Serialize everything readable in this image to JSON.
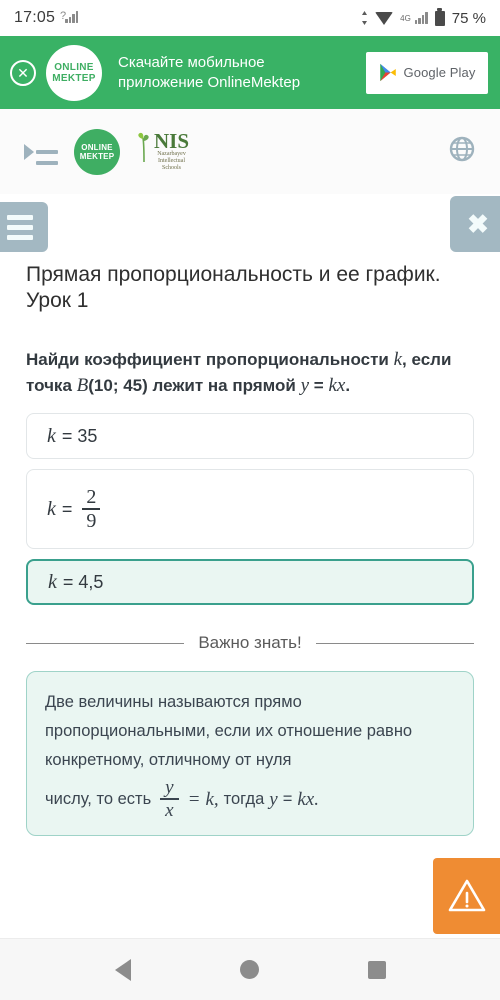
{
  "statusbar": {
    "time": "17:05",
    "signal_icon": "signal-bars-icon",
    "question_mark": "?",
    "arrows": "↕",
    "network": "4G",
    "battery": "75 %"
  },
  "promo": {
    "close_icon": "close-circle-icon",
    "logo_line1": "ONLINE",
    "logo_line2": "MEKTEP",
    "text_line1": "Скачайте мобильное",
    "text_line2": "приложение OnlineMektep",
    "store_button": "Google Play",
    "bg_color": "#39b265"
  },
  "header": {
    "menu_icon": "indent-menu-icon",
    "om_logo_line1": "ONLINE",
    "om_logo_line2": "MEKTEP",
    "nis_logo": "NIS",
    "nis_sub_line1": "Nazarbayev",
    "nis_sub_line2": "Intellectual",
    "nis_sub_line3": "Schools",
    "list_icon": "list-icon",
    "globe_icon": "globe-icon"
  },
  "toolbar": {
    "menu_label": "hamburger-menu",
    "close_label": "✖"
  },
  "lesson": {
    "title": "Прямая пропорциональность и ее график. Урок 1"
  },
  "question": {
    "part1": "Найди коэффициент пропорциональности",
    "var_k": "k",
    "part2": ", если точка",
    "point_b": "B",
    "point_coords": "(10; 45)",
    "part3": "лежит на прямой",
    "formula_y": "y",
    "formula_eq": "=",
    "formula_kx": "kx",
    "period": "."
  },
  "options": [
    {
      "var": "k",
      "eq": "= 35",
      "type": "plain",
      "selected": false
    },
    {
      "var": "k",
      "eq": "=",
      "type": "fraction",
      "numerator": "2",
      "denominator": "9",
      "selected": false
    },
    {
      "var": "k",
      "eq": "= 4,5",
      "type": "plain",
      "selected": true
    }
  ],
  "important": {
    "divider_label": "Важно знать!",
    "text_line1": "Две величины называются прямо пропорциональными, если их отношение равно конкретному, отличному от нуля",
    "text_line2": "числу, то есть",
    "frac_num": "y",
    "frac_den": "x",
    "eq_sign": "=",
    "eq_k": "k,",
    "then_word": "тогда",
    "then_y": "y",
    "then_eq": "=",
    "then_kx": "kx.",
    "border_color": "#9fd3c8",
    "bg_color": "#eaf6f2"
  },
  "fab": {
    "warning_icon": "warning-triangle-icon",
    "color": "#ef8c33"
  },
  "navbar": {
    "back_icon": "back-triangle-icon",
    "home_icon": "home-circle-icon",
    "recent_icon": "recents-square-icon"
  }
}
